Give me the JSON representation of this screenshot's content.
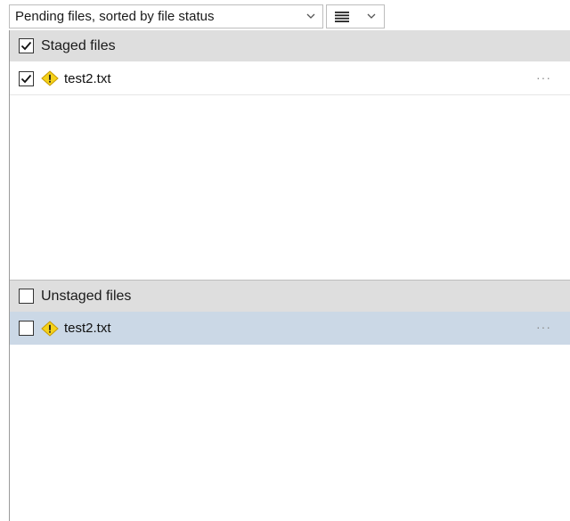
{
  "toolbar": {
    "sort_dropdown": {
      "label": "Pending files, sorted by file status",
      "icon": "chevron-down-icon"
    },
    "view_dropdown": {
      "icon": "list-lines-icon",
      "chevron": "chevron-down-icon"
    }
  },
  "staged": {
    "header_label": "Staged files",
    "checked": true,
    "files": [
      {
        "name": "test2.txt",
        "checked": true,
        "status_icon": "warning-icon",
        "more": "···"
      }
    ]
  },
  "unstaged": {
    "header_label": "Unstaged files",
    "checked": false,
    "files": [
      {
        "name": "test2.txt",
        "checked": false,
        "status_icon": "warning-icon",
        "more": "···",
        "selected": true
      }
    ]
  },
  "colors": {
    "header_bg": "#dedede",
    "selected_row_bg": "#cbd8e6",
    "warning_fill": "#f5d21a",
    "warning_stroke": "#c79a00"
  }
}
